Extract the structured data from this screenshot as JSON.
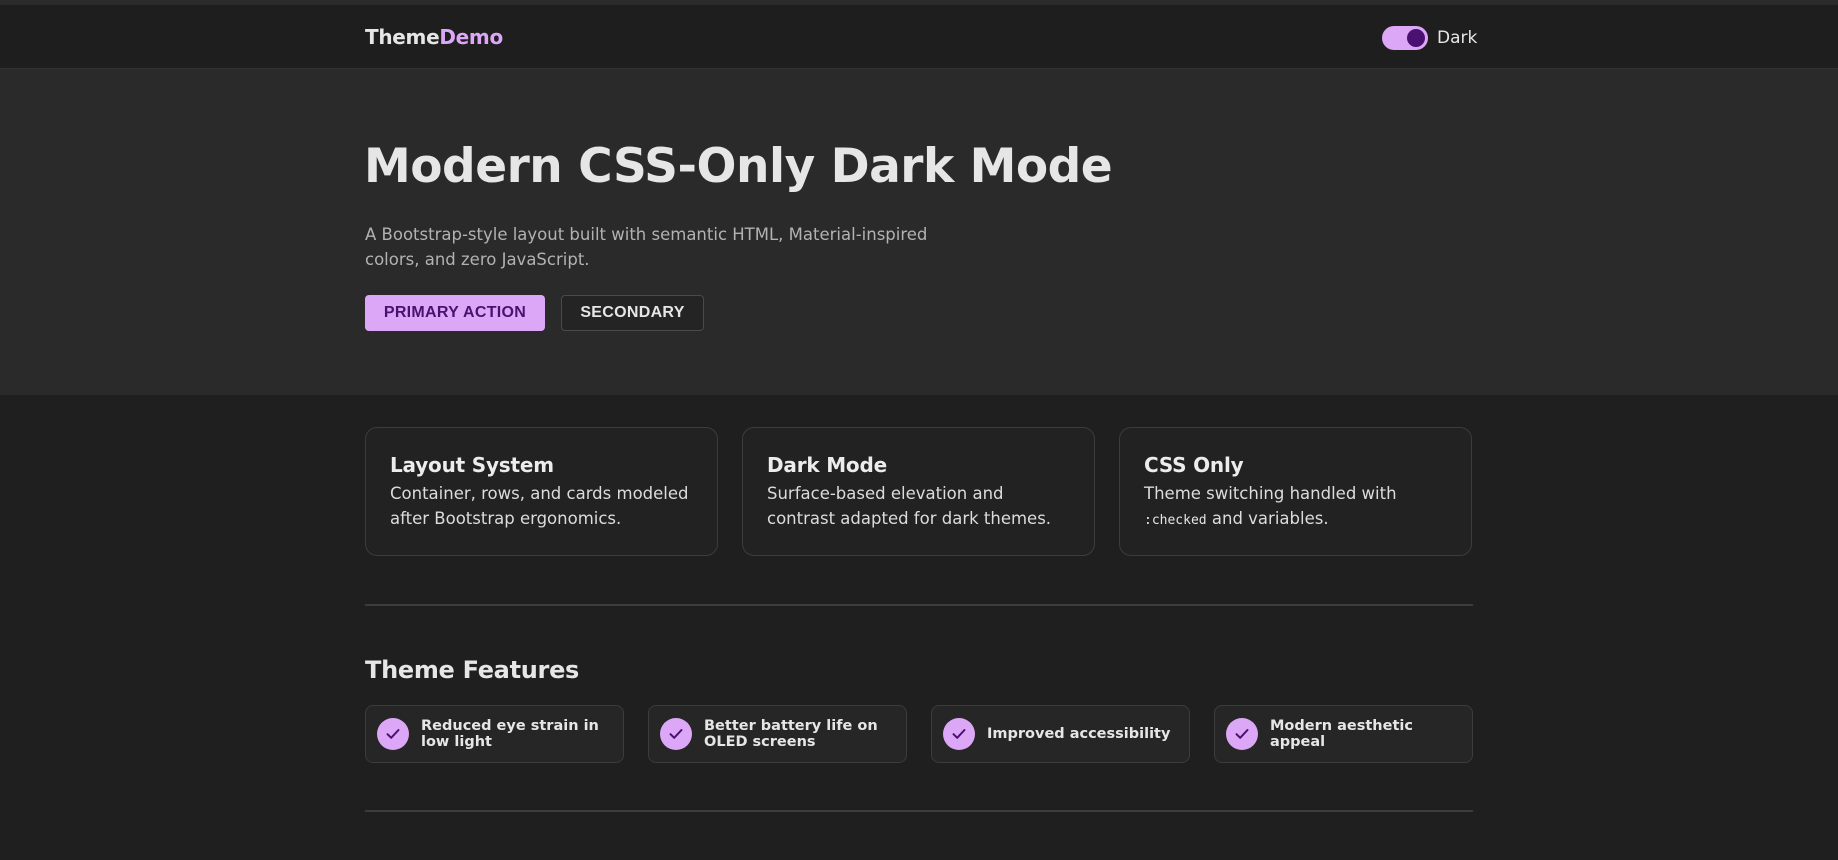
{
  "navbar": {
    "brand_part1": "Theme",
    "brand_part2": "Demo",
    "toggle_label": "Dark"
  },
  "hero": {
    "title": "Modern CSS-Only Dark Mode",
    "subtitle": "A Bootstrap-style layout built with semantic HTML, Material-inspired colors, and zero JavaScript.",
    "primary_button": "PRIMARY ACTION",
    "secondary_button": "SECONDARY"
  },
  "cards": [
    {
      "title": "Layout System",
      "text": "Container, rows, and cards modeled after Bootstrap ergonomics."
    },
    {
      "title": "Dark Mode",
      "text": "Surface-based elevation and contrast adapted for dark themes."
    },
    {
      "title": "CSS Only",
      "text_before": "Theme switching handled with ",
      "code": ":checked",
      "text_after": " and variables."
    }
  ],
  "features_section": {
    "title": "Theme Features",
    "items": [
      {
        "label": "Reduced eye strain in low light",
        "icon": "check-icon"
      },
      {
        "label": "Better battery life on OLED screens",
        "icon": "check-icon"
      },
      {
        "label": "Improved accessibility",
        "icon": "check-icon"
      },
      {
        "label": "Modern aesthetic appeal",
        "icon": "check-icon"
      }
    ]
  },
  "colors": {
    "accent": "#dca7f7",
    "accent_dark": "#4a1170",
    "background": "#1f1f1f",
    "surface": "#2a2a2a"
  },
  "toggle_state": "on"
}
